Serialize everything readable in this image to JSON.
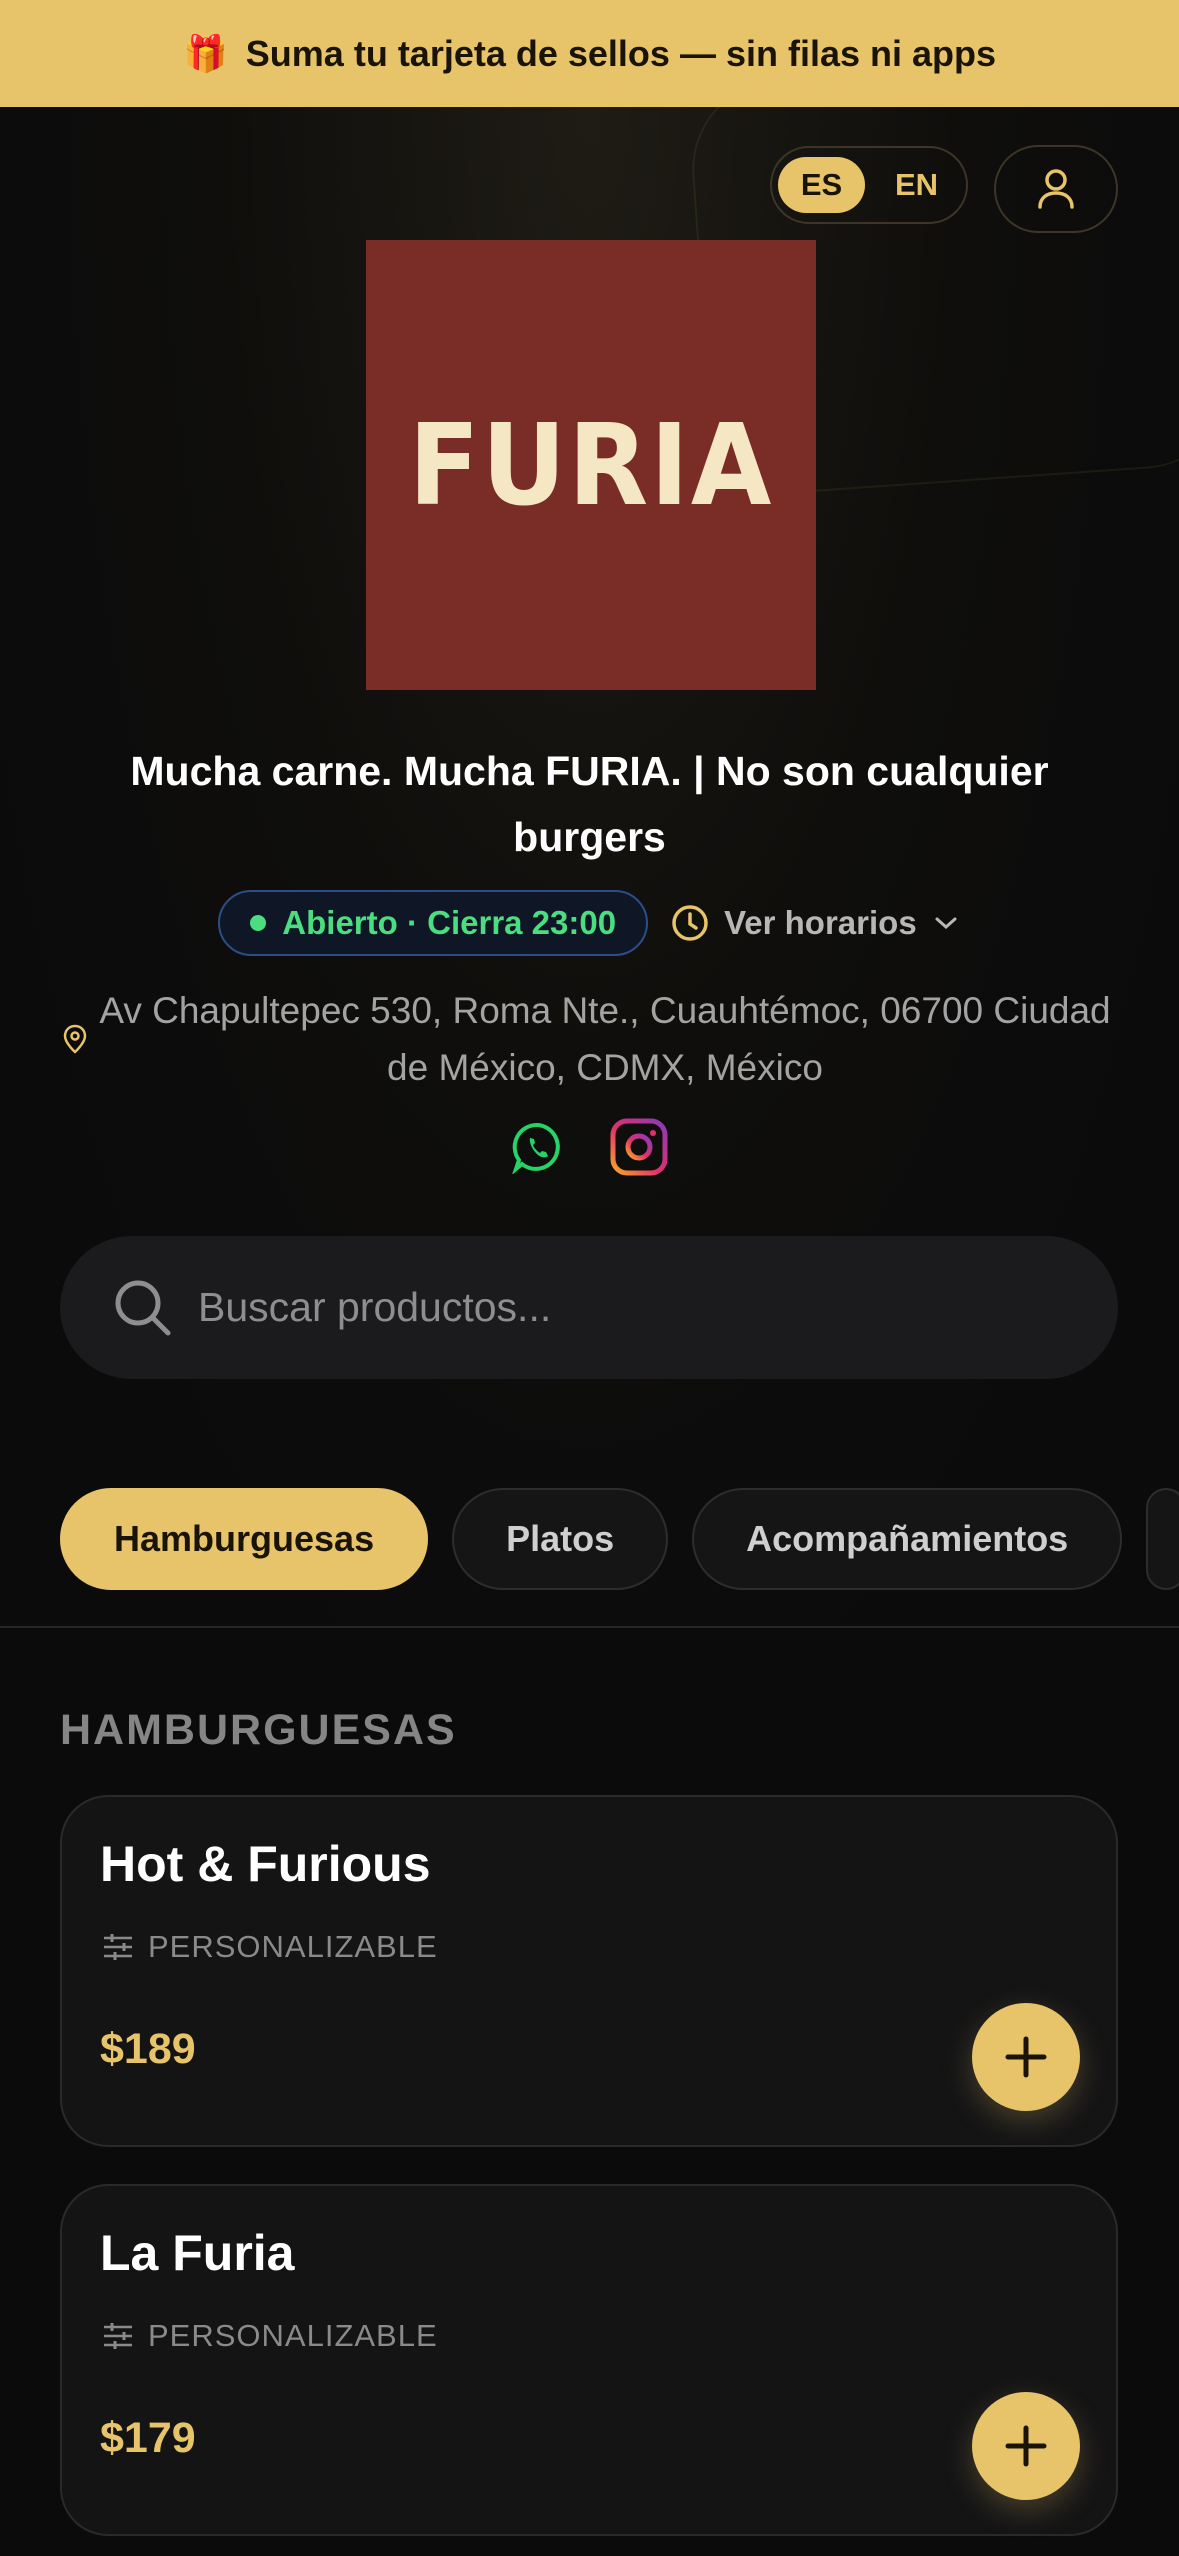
{
  "banner": {
    "icon": "gift-icon",
    "icon_glyph": "🎁",
    "text": "Suma tu tarjeta de sellos — sin filas ni apps"
  },
  "header": {
    "languages": [
      {
        "code": "ES",
        "active": true
      },
      {
        "code": "EN",
        "active": false
      }
    ],
    "user_icon": "user-icon"
  },
  "restaurant": {
    "logo_text": "FURIA",
    "logo_bg": "#7a2c26",
    "tagline": "Mucha carne. Mucha FURIA. | No son cualquier burgers",
    "status": "Abierto · Cierra 23:00",
    "status_color": "#4ade80",
    "hours_label": "Ver horarios",
    "address": "Av Chapultepec 530, Roma Nte., Cuauhtémoc, 06700 Ciudad de México, CDMX, México",
    "socials": [
      "whatsapp-icon",
      "instagram-icon"
    ]
  },
  "search": {
    "placeholder": "Buscar productos..."
  },
  "categories": [
    {
      "label": "Hamburguesas",
      "active": true
    },
    {
      "label": "Platos",
      "active": false
    },
    {
      "label": "Acompañamientos",
      "active": false
    }
  ],
  "section": {
    "title": "HAMBURGUESAS"
  },
  "products": [
    {
      "name": "Hot & Furious",
      "tag": "PERSONALIZABLE",
      "price": "$189"
    },
    {
      "name": "La Furia",
      "tag": "PERSONALIZABLE",
      "price": "$179"
    }
  ],
  "colors": {
    "accent": "#e7c46a",
    "background": "#0b0b0c",
    "card": "#141415"
  }
}
